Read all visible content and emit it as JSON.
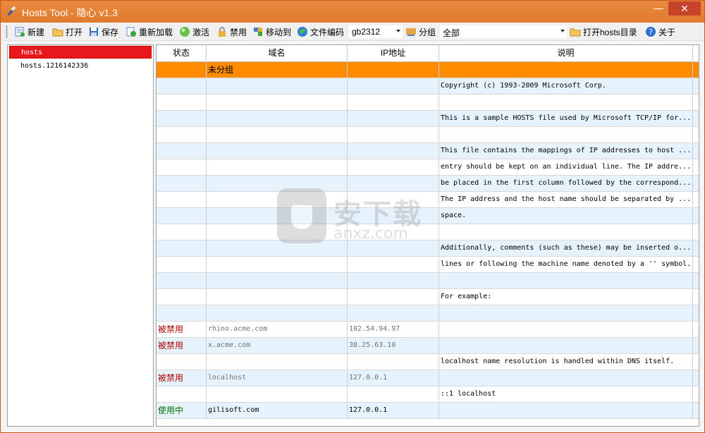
{
  "window": {
    "title": "Hosts Tool - 隐心 v1.3",
    "close": "✕",
    "minimize": "—"
  },
  "toolbar": {
    "new": "新建",
    "open": "打开",
    "save": "保存",
    "reload": "重新加载",
    "activate": "激活",
    "disable": "禁用",
    "move_to": "移动到",
    "encoding_label": "文件编码",
    "encoding_value": "gb2312",
    "group_label": "分组",
    "group_value": "全部",
    "open_hosts_dir": "打开hosts目录",
    "about": "关于"
  },
  "tree": {
    "items": [
      "hosts",
      "hosts.1216142336"
    ]
  },
  "grid": {
    "columns": [
      "状态",
      "域名",
      "IP地址",
      "说明"
    ],
    "rows": [
      {
        "status": "",
        "domain": "未分组",
        "ip": "",
        "note": "",
        "kind": "group"
      },
      {
        "status": "",
        "domain": "",
        "ip": "",
        "note": "Copyright (c) 1993-2009 Microsoft Corp.",
        "kind": "alt"
      },
      {
        "status": "",
        "domain": "",
        "ip": "",
        "note": "",
        "kind": "plain"
      },
      {
        "status": "",
        "domain": "",
        "ip": "",
        "note": "This is a sample HOSTS file used by Microsoft TCP/IP for...",
        "kind": "alt"
      },
      {
        "status": "",
        "domain": "",
        "ip": "",
        "note": "",
        "kind": "plain"
      },
      {
        "status": "",
        "domain": "",
        "ip": "",
        "note": "This file contains the mappings of IP addresses to host ...",
        "kind": "alt"
      },
      {
        "status": "",
        "domain": "",
        "ip": "",
        "note": "entry should be kept on an individual line. The IP addre...",
        "kind": "plain"
      },
      {
        "status": "",
        "domain": "",
        "ip": "",
        "note": "be placed in the first column followed by the correspond...",
        "kind": "alt"
      },
      {
        "status": "",
        "domain": "",
        "ip": "",
        "note": "The IP address and the host name should be separated by ...",
        "kind": "plain"
      },
      {
        "status": "",
        "domain": "",
        "ip": "",
        "note": "space.",
        "kind": "alt"
      },
      {
        "status": "",
        "domain": "",
        "ip": "",
        "note": "",
        "kind": "plain"
      },
      {
        "status": "",
        "domain": "",
        "ip": "",
        "note": "Additionally, comments (such as these) may be inserted o...",
        "kind": "alt"
      },
      {
        "status": "",
        "domain": "",
        "ip": "",
        "note": "lines or following the machine name denoted by a '' symbol.",
        "kind": "plain"
      },
      {
        "status": "",
        "domain": "",
        "ip": "",
        "note": "",
        "kind": "alt"
      },
      {
        "status": "",
        "domain": "",
        "ip": "",
        "note": "For example:",
        "kind": "plain"
      },
      {
        "status": "",
        "domain": "",
        "ip": "",
        "note": "",
        "kind": "alt"
      },
      {
        "status": "被禁用",
        "domain": "rhino.acme.com",
        "ip": "102.54.94.97",
        "note": "",
        "kind": "plain"
      },
      {
        "status": "被禁用",
        "domain": "x.acme.com",
        "ip": "38.25.63.10",
        "note": "",
        "kind": "alt"
      },
      {
        "status": "",
        "domain": "",
        "ip": "",
        "note": "localhost name resolution is handled within DNS itself.",
        "kind": "plain"
      },
      {
        "status": "被禁用",
        "domain": "localhost",
        "ip": "127.0.0.1",
        "note": "",
        "kind": "alt"
      },
      {
        "status": "",
        "domain": "",
        "ip": "",
        "note": "::1 localhost",
        "kind": "plain"
      },
      {
        "status": "使用中",
        "domain": "gilisoft.com",
        "ip": "127.0.0.1",
        "note": "",
        "kind": "alt"
      }
    ]
  },
  "watermark": {
    "text": "安下载",
    "sub": "anxz.com"
  },
  "colors": {
    "titlebar": "#e07a2c",
    "group_row": "#ff8b00",
    "selected_tree": "#e8191d",
    "alt_row": "#e6f3fc",
    "disabled": "#b00000",
    "enabled": "#007000"
  }
}
